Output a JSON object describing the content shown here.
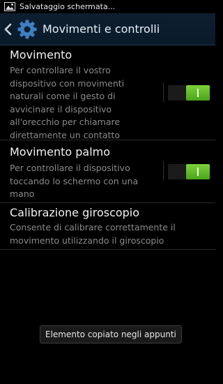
{
  "status_bar": {
    "notification_icon": "image-icon",
    "notification_text": "Salvataggio schermata..."
  },
  "action_bar": {
    "back_icon": "chevron-left-icon",
    "app_icon": "gear-icon",
    "title": "Movimenti e controlli"
  },
  "settings": [
    {
      "title": "Movimento",
      "summary": "Per controllare il vostro dispositivo con movimenti naturali come il gesto di avvicinare il dispositivo all'orecchio per chiamare direttamente un contatto",
      "toggle": true
    },
    {
      "title": "Movimento palmo",
      "summary": "Per controllare il dispositivo toccando lo schermo con una mano",
      "toggle": true
    },
    {
      "title": "Calibrazione giroscopio",
      "summary": "Consente di calibrare correttamente il movimento utilizzando il giroscopio"
    }
  ],
  "toast": {
    "text": "Elemento copiato negli appunti"
  },
  "colors": {
    "accent_blue": "#3e7fc1",
    "switch_on": "#5fbf25",
    "background": "#000000"
  }
}
